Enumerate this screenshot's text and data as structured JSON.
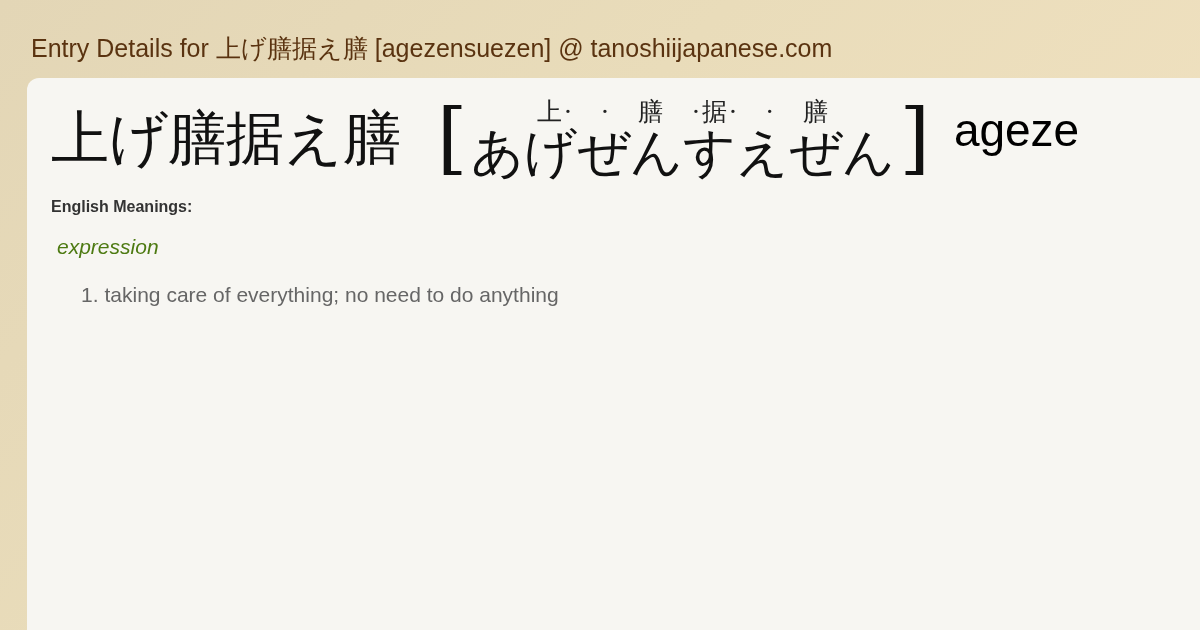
{
  "page_title": "Entry Details for 上げ膳据え膳 [agezensuezen] @ tanoshiijapanese.com",
  "entry": {
    "kanji": "上げ膳据え膳",
    "open_bracket": "[",
    "furigana": "上·　·　膳　·据·　·　膳",
    "kana": "あげぜんすえぜん",
    "close_bracket": "]",
    "romaji": "ageze"
  },
  "meanings_label": "English Meanings:",
  "part_of_speech": "expression",
  "meanings": [
    "taking care of everything; no need to do anything"
  ],
  "meaning_numbers": [
    "1."
  ]
}
